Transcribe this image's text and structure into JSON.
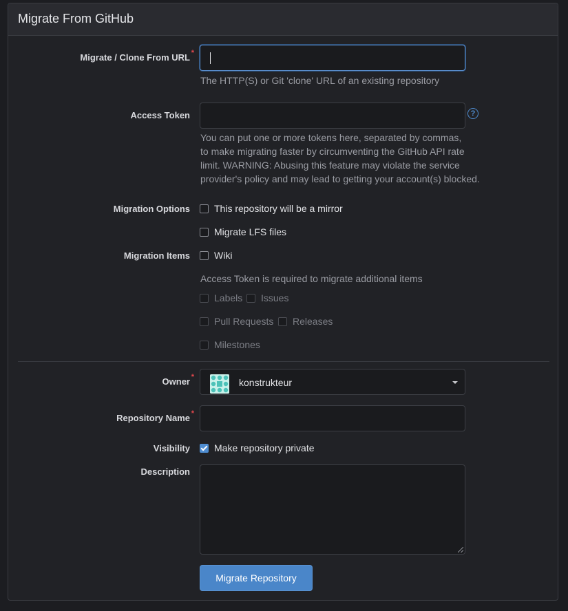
{
  "title": "Migrate From GitHub",
  "url_field": {
    "label": "Migrate / Clone From URL",
    "required_mark": "*",
    "value": "",
    "help": "The HTTP(S) or Git 'clone' URL of an existing repository"
  },
  "token_field": {
    "label": "Access Token",
    "value": "",
    "help_icon": "question-circle-icon",
    "help_lines": [
      "You can put one or more tokens here, separated by commas,",
      "to make migrating faster by circumventing the GitHub API rate",
      "limit. WARNING: Abusing this feature may violate the service",
      "provider's policy and may lead to getting your account(s) blocked."
    ]
  },
  "migration_options": {
    "label": "Migration Options",
    "mirror": {
      "label": "This repository will be a mirror",
      "checked": false
    },
    "lfs": {
      "label": "Migrate LFS files",
      "checked": false
    }
  },
  "migration_items": {
    "label": "Migration Items",
    "wiki": {
      "label": "Wiki",
      "checked": false
    },
    "note": "Access Token is required to migrate additional items",
    "disabled_items": [
      "Labels",
      "Issues",
      "Pull Requests",
      "Releases",
      "Milestones"
    ]
  },
  "owner": {
    "label": "Owner",
    "required_mark": "*",
    "selected": "konstrukteur"
  },
  "repo_name": {
    "label": "Repository Name",
    "required_mark": "*",
    "value": ""
  },
  "visibility": {
    "label": "Visibility",
    "option_label": "Make repository private",
    "checked": true
  },
  "description": {
    "label": "Description",
    "value": ""
  },
  "submit_label": "Migrate Repository",
  "colors": {
    "accent": "#4a86c9",
    "required": "#e5484d",
    "background": "#1c1d21"
  }
}
